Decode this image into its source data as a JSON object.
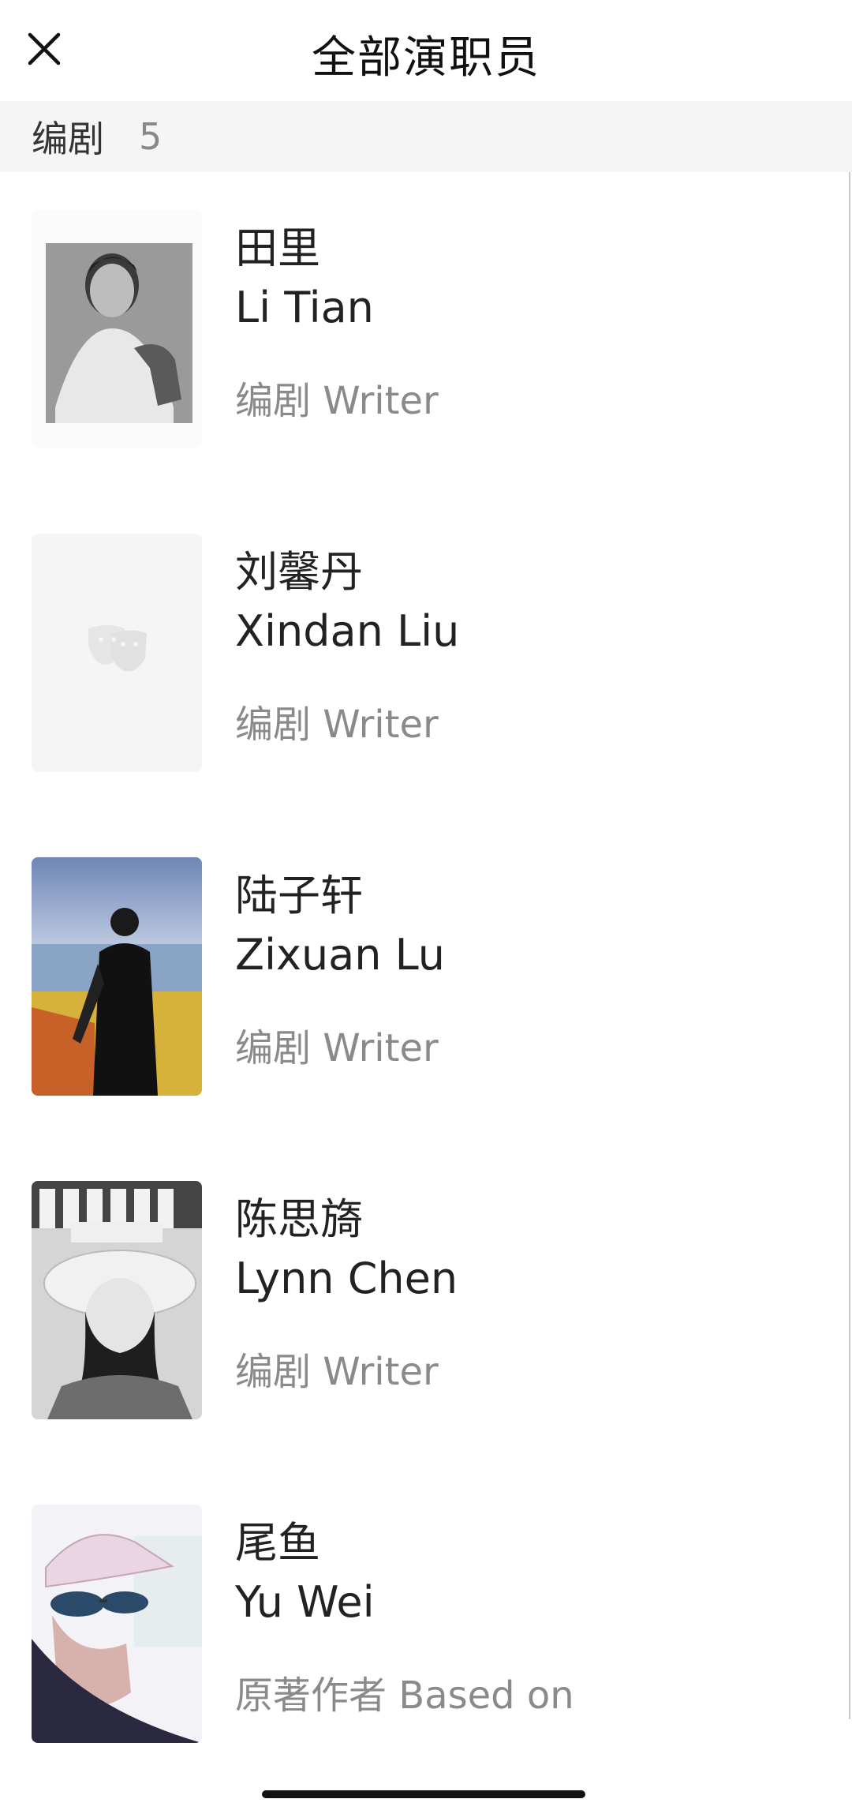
{
  "header": {
    "title": "全部演职员",
    "close_icon": "close-icon"
  },
  "section": {
    "label": "编剧",
    "count": "5"
  },
  "people": [
    {
      "name_zh": "田里",
      "name_en": "Li Tian",
      "role": "编剧 Writer",
      "photo": "portrait-bw"
    },
    {
      "name_zh": "刘馨丹",
      "name_en": "Xindan Liu",
      "role": "编剧 Writer",
      "photo": "placeholder-theater-masks-icon"
    },
    {
      "name_zh": "陆子轩",
      "name_en": "Zixuan Lu",
      "role": "编剧 Writer",
      "photo": "outdoor-photo"
    },
    {
      "name_zh": "陈思旖",
      "name_en": "Lynn Chen",
      "role": "编剧 Writer",
      "photo": "portrait-bw-hat"
    },
    {
      "name_zh": "尾鱼",
      "name_en": "Yu Wei",
      "role": "原著作者 Based on",
      "photo": "portrait-cap-sunglasses"
    }
  ],
  "colors": {
    "section_bg": "#f5f5f5",
    "text_primary": "#222222",
    "text_secondary": "#8a8a8a"
  }
}
